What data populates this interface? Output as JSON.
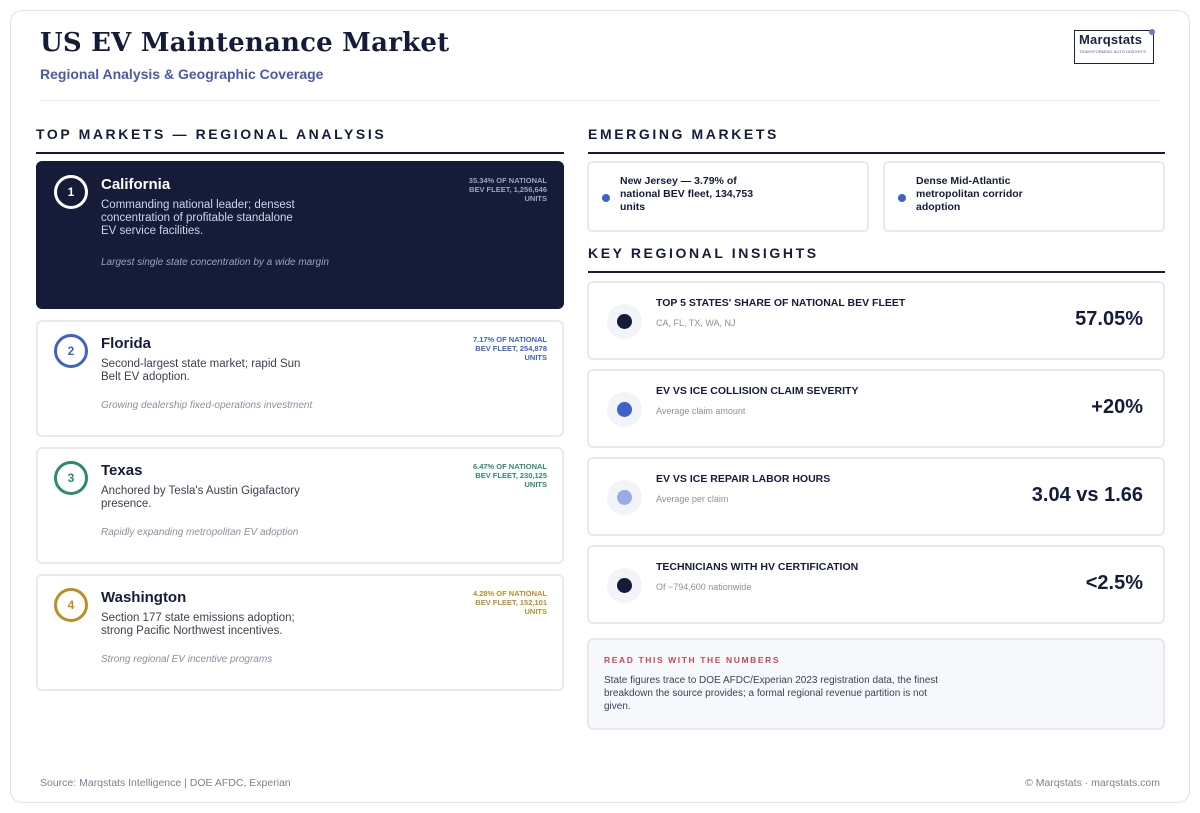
{
  "header": {
    "title": "US EV Maintenance Market",
    "subtitle": "Regional Analysis & Geographic Coverage",
    "logo_word": "Marqstats",
    "logo_tagline": "TRANSFORMING AUTO INSIGHTS"
  },
  "top_markets": {
    "heading": "TOP MARKETS — REGIONAL ANALYSIS",
    "items": [
      {
        "rank": "1",
        "name": "California",
        "description": "Commanding national leader; densest concentration of profitable standalone EV service facilities.",
        "note": "Largest single state concentration by a wide margin",
        "share": "35.34% OF NATIONAL BEV FLEET, 1,256,646 UNITS",
        "accent": "#ffffff",
        "share_color": "#9aa3c4"
      },
      {
        "rank": "2",
        "name": "Florida",
        "description": "Second-largest state market; rapid Sun Belt EV adoption.",
        "note": "Growing dealership fixed-operations investment",
        "share": "7.17% OF NATIONAL BEV FLEET, 254,878 UNITS",
        "accent": "#3d63c9",
        "share_color": "#3d63c9"
      },
      {
        "rank": "3",
        "name": "Texas",
        "description": "Anchored by Tesla's Austin Gigafactory presence.",
        "note": "Rapidly expanding metropolitan EV adoption",
        "share": "6.47% OF NATIONAL BEV FLEET, 230,125 UNITS",
        "accent": "#2e8a6a",
        "share_color": "#2e8a6a"
      },
      {
        "rank": "4",
        "name": "Washington",
        "description": "Section 177 state emissions adoption; strong Pacific Northwest incentives.",
        "note": "Strong regional EV incentive programs",
        "share": "4.28% OF NATIONAL BEV FLEET, 152,101 UNITS",
        "accent": "#b8902a",
        "share_color": "#b8902a"
      }
    ]
  },
  "emerging": {
    "heading": "EMERGING MARKETS",
    "items": [
      {
        "text": "New Jersey — 3.79% of national BEV fleet, 134,753 units"
      },
      {
        "text": "Dense Mid-Atlantic metropolitan corridor adoption"
      }
    ]
  },
  "insights": {
    "heading": "KEY REGIONAL INSIGHTS",
    "items": [
      {
        "title": "TOP 5 STATES' SHARE OF NATIONAL BEV FLEET",
        "subtitle": "CA, FL, TX, WA, NJ",
        "value": "57.05%",
        "dot_color": "#141c3a"
      },
      {
        "title": "EV VS ICE COLLISION CLAIM SEVERITY",
        "subtitle": "Average claim amount",
        "value": "+20%",
        "dot_color": "#3d63c9"
      },
      {
        "title": "EV VS ICE REPAIR LABOR HOURS",
        "subtitle": "Average per claim",
        "value": "3.04 vs 1.66",
        "dot_color": "#98abe6"
      },
      {
        "title": "TECHNICIANS WITH HV CERTIFICATION",
        "subtitle": "Of ~794,600 nationwide",
        "value": "<2.5%",
        "dot_color": "#141c3a"
      }
    ]
  },
  "read_box": {
    "heading": "READ THIS WITH THE NUMBERS",
    "body": "State figures trace to DOE AFDC/Experian 2023 registration data, the finest breakdown the source provides; a formal regional revenue partition is not given."
  },
  "footer": {
    "source": "Source: Marqstats Intelligence | DOE AFDC, Experian",
    "copyright": "© Marqstats · marqstats.com"
  }
}
